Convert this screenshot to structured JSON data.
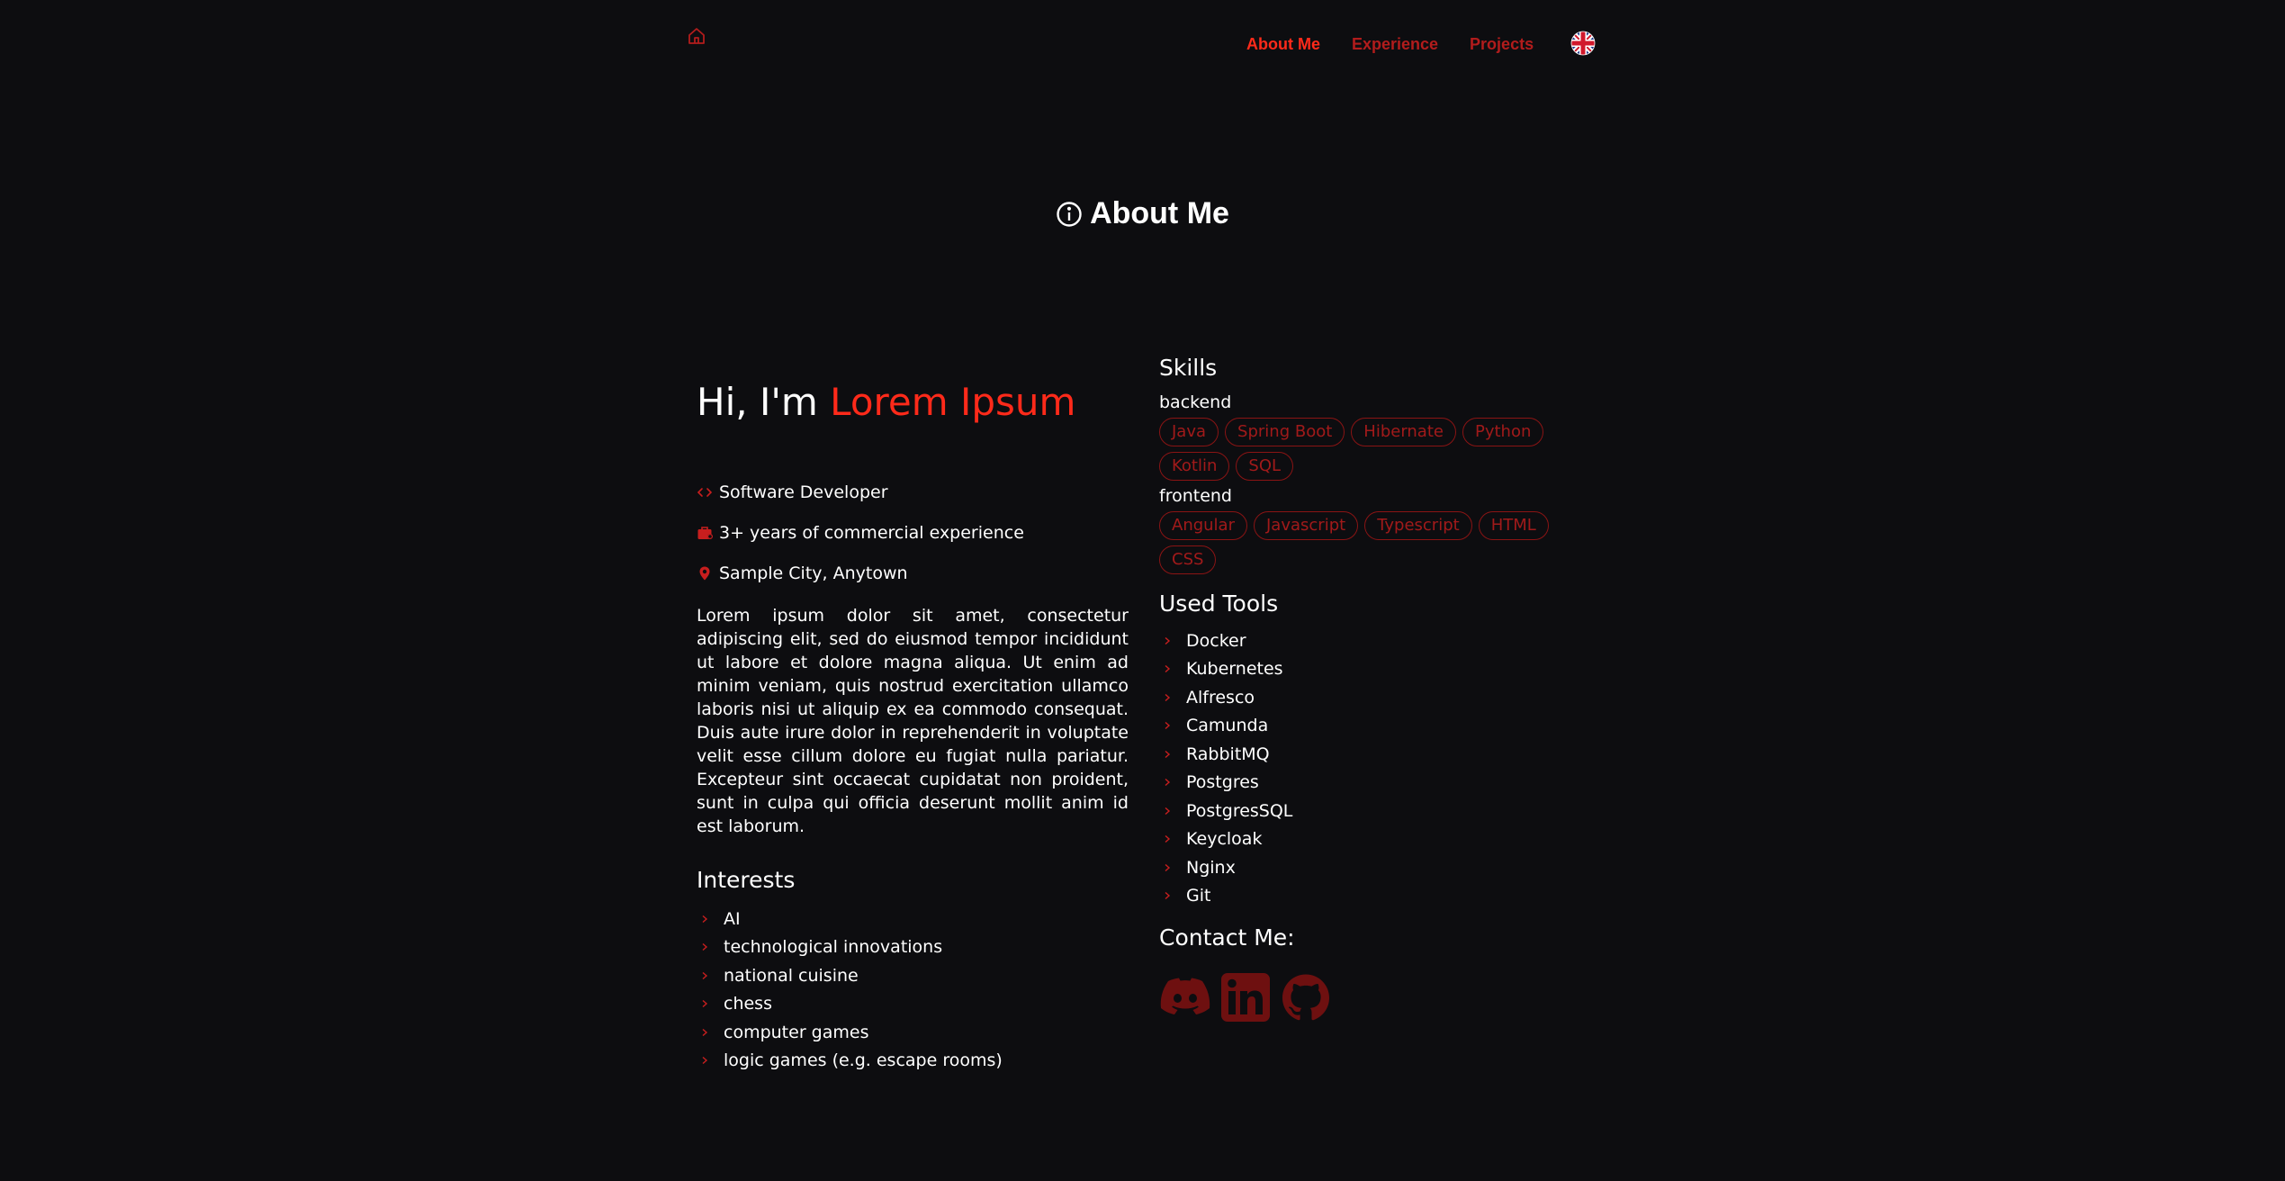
{
  "nav": {
    "home_icon": "home-icon",
    "items": [
      {
        "label": "About Me",
        "active": true
      },
      {
        "label": "Experience",
        "active": false
      },
      {
        "label": "Projects",
        "active": false
      }
    ],
    "language_icon": "uk-flag-icon"
  },
  "section": {
    "title": "About Me",
    "icon": "info-circle-icon"
  },
  "intro": {
    "greeting": "Hi, I'm ",
    "name": "Lorem Ipsum",
    "role": "Software Developer",
    "experience": "3+ years of commercial experience",
    "location": "Sample City, Anytown",
    "bio": "Lorem ipsum dolor sit amet, consectetur adipiscing elit, sed do eiusmod tempor incididunt ut labore et dolore magna aliqua. Ut enim ad minim veniam, quis nostrud exercitation ullamco laboris nisi ut aliquip ex ea commodo consequat. Duis aute irure dolor in reprehenderit in voluptate velit esse cillum dolore eu fugiat nulla pariatur. Excepteur sint occaecat cupidatat non proident, sunt in culpa qui officia deserunt mollit anim id est laborum."
  },
  "interests": {
    "title": "Interests",
    "items": [
      "AI",
      "technological innovations",
      "national cuisine",
      "chess",
      "computer games",
      "logic games (e.g. escape rooms)"
    ]
  },
  "skills": {
    "title": "Skills",
    "groups": [
      {
        "label": "backend",
        "tags": [
          "Java",
          "Spring Boot",
          "Hibernate",
          "Python",
          "Kotlin",
          "SQL"
        ]
      },
      {
        "label": "frontend",
        "tags": [
          "Angular",
          "Javascript",
          "Typescript",
          "HTML",
          "CSS"
        ]
      }
    ]
  },
  "tools": {
    "title": "Used Tools",
    "items": [
      "Docker",
      "Kubernetes",
      "Alfresco",
      "Camunda",
      "RabbitMQ",
      "Postgres",
      "PostgresSQL",
      "Keycloak",
      "Nginx",
      "Git"
    ]
  },
  "contact": {
    "title": "Contact Me:",
    "links": [
      "discord-icon",
      "linkedin-icon",
      "github-icon"
    ]
  },
  "colors": {
    "background": "#0d0d10",
    "accent": "#ff2a1a",
    "accent_dim": "#b21c1c",
    "text": "#ffffff"
  }
}
